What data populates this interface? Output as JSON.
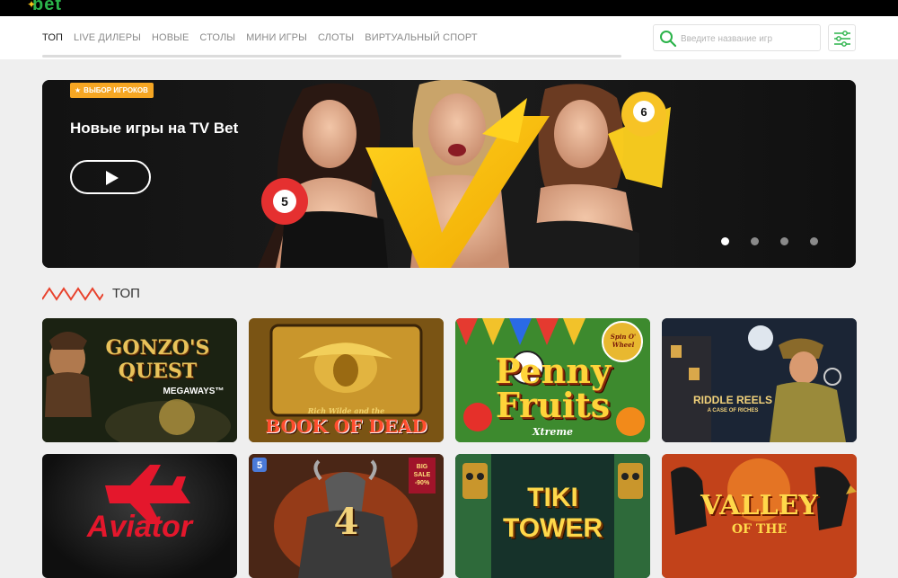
{
  "header": {
    "logo": "bet"
  },
  "nav": {
    "tabs": [
      "ТОП",
      "LIVE ДИЛЕРЫ",
      "НОВЫЕ",
      "СТОЛЫ",
      "МИНИ ИГРЫ",
      "СЛОТЫ",
      "ВИРТУАЛЬНЫЙ СПОРТ"
    ],
    "active_tab": "ТОП",
    "search_placeholder": "Введите название игр"
  },
  "banner": {
    "badge": "ВЫБОР ИГРОКОВ",
    "title": "Новые игры на TV Bet",
    "ball_left": "5",
    "ball_right": "6",
    "slides": 4,
    "active_slide": 1
  },
  "section": {
    "title": "ТОП"
  },
  "games": [
    {
      "title": "GONZO'S QUEST",
      "subtitle": "MEGAWAYS™"
    },
    {
      "title": "BOOK OF DEAD",
      "subtitle": "Rich Wilde and the"
    },
    {
      "title": "Penny Fruits",
      "subtitle": "Xtreme",
      "badge": "Spin O' Wheel"
    },
    {
      "title": "RIDDLE REELS",
      "subtitle": "A CASE OF RICHES"
    },
    {
      "title": "Aviator",
      "subtitle": ""
    },
    {
      "title": "4",
      "subtitle": "",
      "badge": "BIG SALE -90%"
    },
    {
      "title": "TIKI TOWER",
      "subtitle": ""
    },
    {
      "title": "VALLEY",
      "subtitle": "OF THE"
    }
  ],
  "colors": {
    "accent_green": "#2bb34a",
    "badge_orange": "#f5a623",
    "wave_red": "#e8412c"
  }
}
